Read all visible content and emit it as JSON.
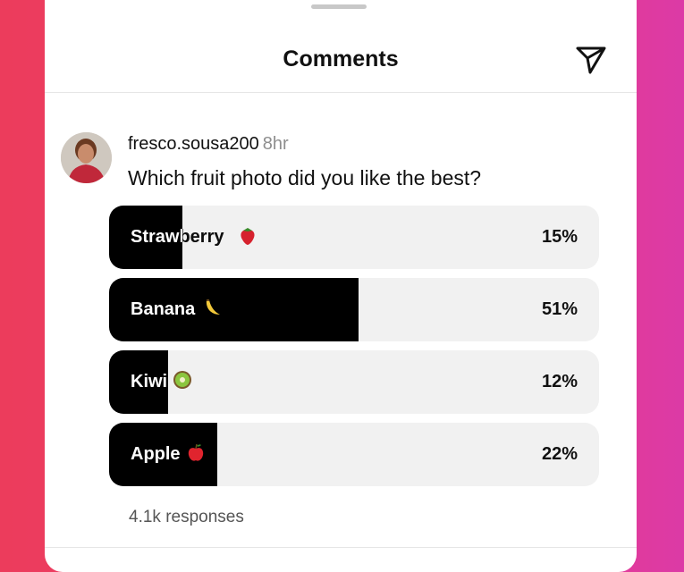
{
  "header": {
    "title": "Comments",
    "share_icon": "send-icon"
  },
  "post": {
    "username": "fresco.sousa200",
    "time": "8hr",
    "question": "Which fruit photo did you like the best?"
  },
  "poll": {
    "options": [
      {
        "label": "Strawberry",
        "emoji": "strawberry-icon",
        "percent_text": "15%",
        "fraction": 0.15
      },
      {
        "label": "Banana",
        "emoji": "banana-icon",
        "percent_text": "51%",
        "fraction": 0.51
      },
      {
        "label": "Kiwi",
        "emoji": "kiwi-icon",
        "percent_text": "12%",
        "fraction": 0.12
      },
      {
        "label": "Apple",
        "emoji": "apple-icon",
        "percent_text": "22%",
        "fraction": 0.22
      }
    ],
    "responses": "4.1k responses"
  },
  "colors": {
    "fill": "#000000",
    "track": "#f1f1f1",
    "background_left": "#ec3c5c",
    "background_right": "#dc3aa6"
  }
}
